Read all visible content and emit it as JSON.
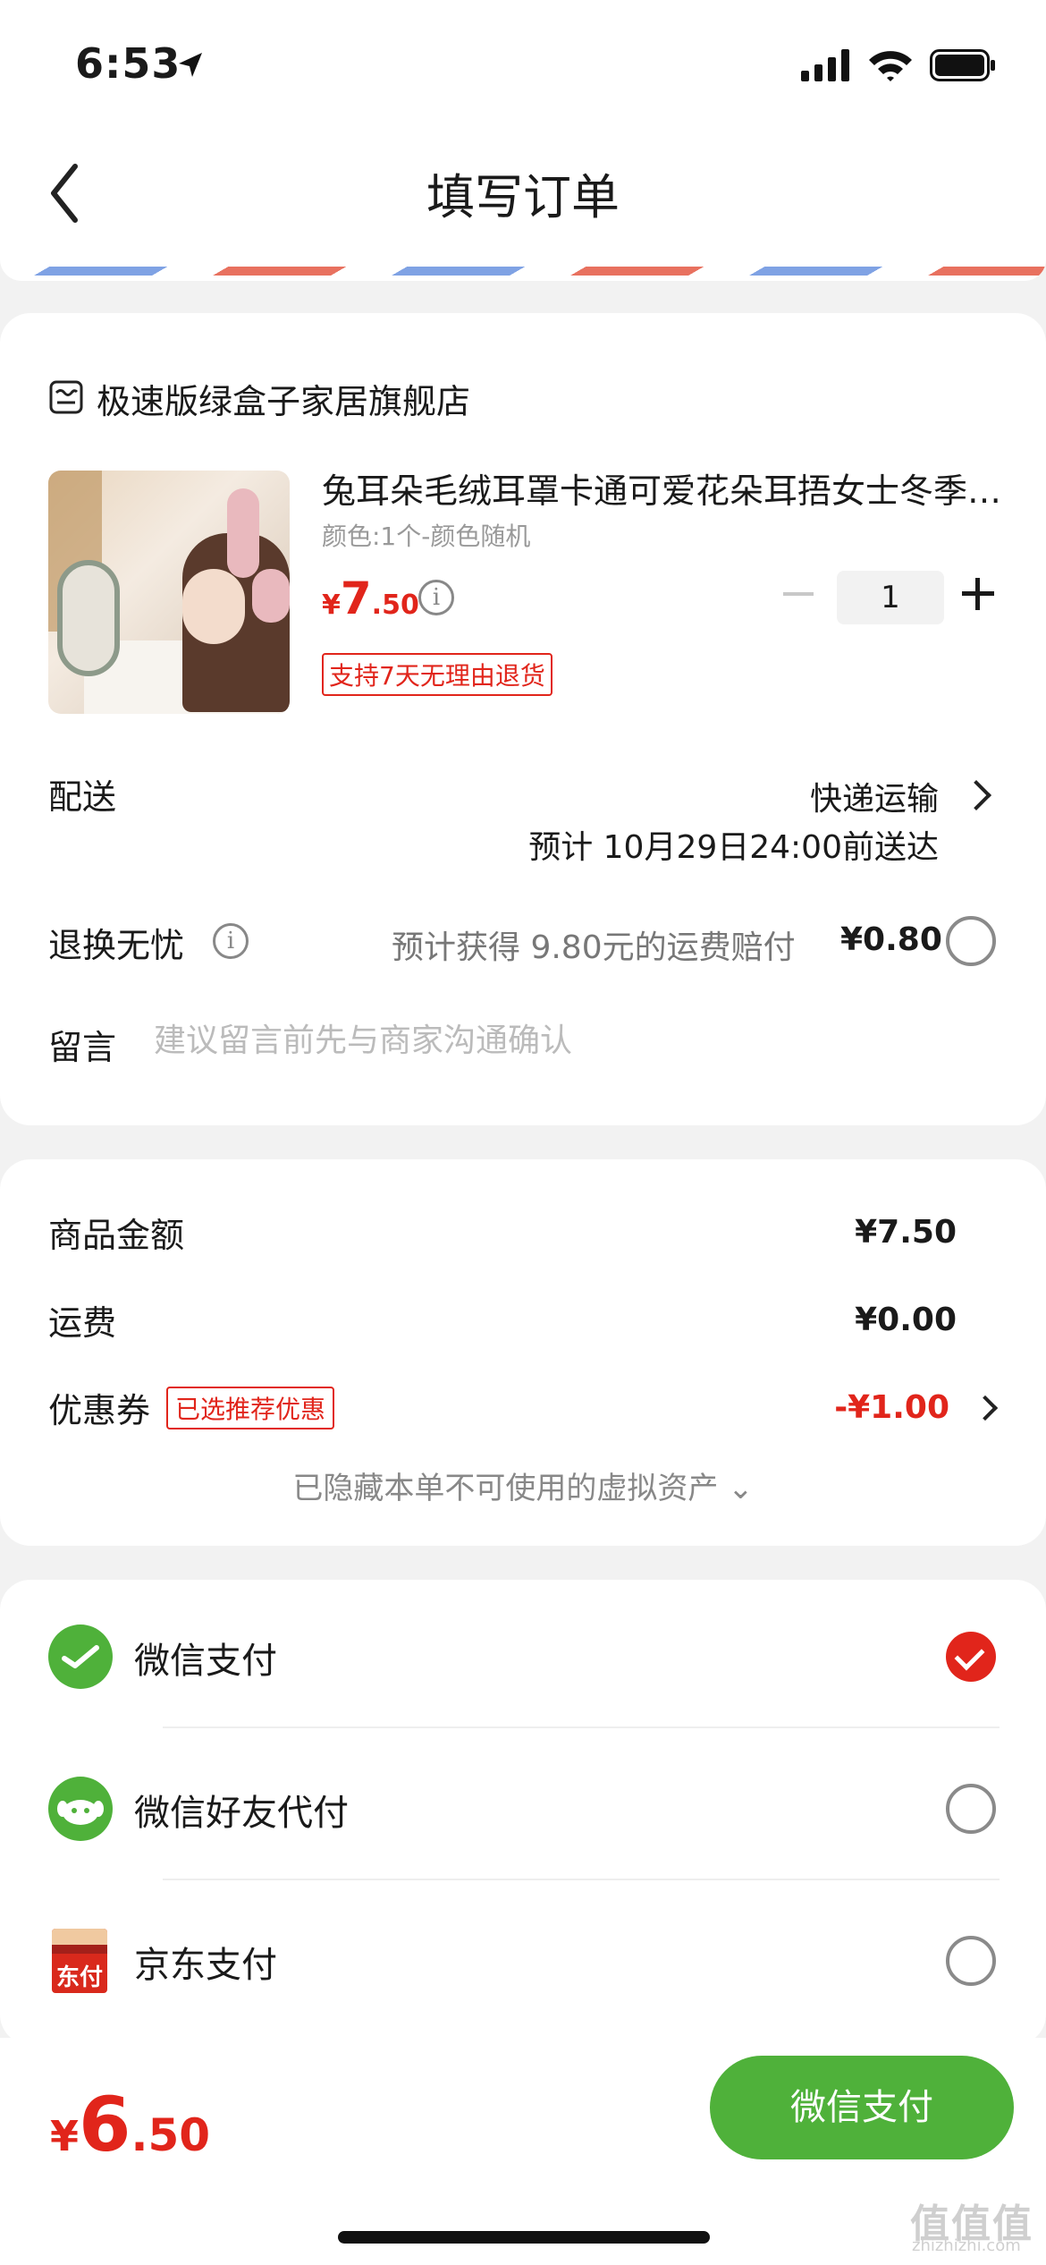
{
  "status_bar": {
    "time": "6:53"
  },
  "nav": {
    "title": "填写订单"
  },
  "shop": {
    "name": "极速版绿盒子家居旗舰店"
  },
  "product": {
    "title": "兔耳朵毛绒耳罩卡通可爱花朵耳捂女士冬季保暖",
    "spec": "颜色:1个-颜色随机",
    "price_currency": "¥",
    "price_int": "7",
    "price_dec": ".50",
    "quantity": "1",
    "return_badge": "支持7天无理由退货"
  },
  "shipping": {
    "label": "配送",
    "method": "快递运输",
    "eta": "预计 10月29日24:00前送达"
  },
  "return_insurance": {
    "label": "退换无忧",
    "desc": "预计获得 9.80元的运费赔付",
    "price": "¥0.80"
  },
  "message": {
    "label": "留言",
    "placeholder": "建议留言前先与商家沟通确认"
  },
  "summary": {
    "goods_label": "商品金额",
    "goods_value": "¥7.50",
    "freight_label": "运费",
    "freight_value": "¥0.00",
    "coupon_label": "优惠券",
    "coupon_badge": "已选推荐优惠",
    "coupon_value": "-¥1.00",
    "hidden_assets": "已隐藏本单不可使用的虚拟资产 ⌄"
  },
  "payment": {
    "methods": [
      {
        "label": "微信支付",
        "selected": true
      },
      {
        "label": "微信好友代付",
        "selected": false
      },
      {
        "label": "京东支付",
        "selected": false
      }
    ],
    "jd_icon_text": "东付"
  },
  "bottom": {
    "total_currency": "¥",
    "total_int": "6",
    "total_dec": ".50",
    "pay_button": "微信支付"
  },
  "watermark": {
    "text": "值值值",
    "sub": "zhizhizhi.com"
  },
  "colors": {
    "accent": "#e1251b",
    "wechat_green": "#4fb13a"
  }
}
